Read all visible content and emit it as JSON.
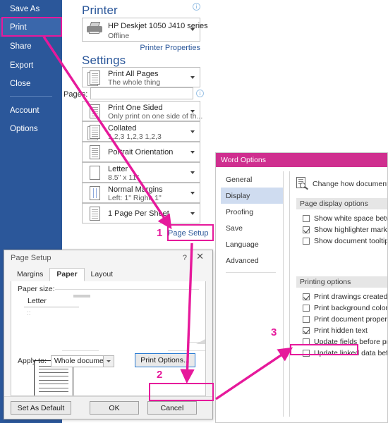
{
  "backstage": {
    "items": [
      {
        "label": "Save As",
        "selected": false
      },
      {
        "label": "Print",
        "selected": true
      },
      {
        "label": "Share",
        "selected": false
      },
      {
        "label": "Export",
        "selected": false
      },
      {
        "label": "Close",
        "selected": false
      },
      {
        "label": "Account",
        "selected": false
      },
      {
        "label": "Options",
        "selected": false
      }
    ]
  },
  "print_pane": {
    "printer_heading": "Printer",
    "printer_name": "HP Deskjet 1050 J410 series",
    "printer_status": "Offline",
    "printer_properties_link": "Printer Properties",
    "settings_heading": "Settings",
    "pages_label": "Pages:",
    "pages_value": "",
    "page_setup_link": "Page Setup",
    "info_icon": "info-icon",
    "settings": [
      {
        "icon": "document-icon",
        "line1": "Print All Pages",
        "line2": "The whole thing"
      },
      {
        "icon": "one-sided-icon",
        "line1": "Print One Sided",
        "line2": "Only print on one side of th..."
      },
      {
        "icon": "collated-icon",
        "line1": "Collated",
        "line2": "1,2,3   1,2,3   1,2,3"
      },
      {
        "icon": "orientation-icon",
        "line1": "Portrait Orientation",
        "line2": ""
      },
      {
        "icon": "paper-size-icon",
        "line1": "Letter",
        "line2": "8.5\" x 11\""
      },
      {
        "icon": "margins-icon",
        "line1": "Normal Margins",
        "line2": "Left:  1\"    Right:  1\""
      },
      {
        "icon": "pages-per-sheet-icon",
        "line1": "1 Page Per Sheet",
        "line2": ""
      }
    ]
  },
  "word_options": {
    "title": "Word Options",
    "nav": [
      {
        "label": "General",
        "selected": false
      },
      {
        "label": "Display",
        "selected": true
      },
      {
        "label": "Proofing",
        "selected": false
      },
      {
        "label": "Save",
        "selected": false
      },
      {
        "label": "Language",
        "selected": false
      },
      {
        "label": "Advanced",
        "selected": false
      }
    ],
    "header_text": "Change how document content is",
    "page_display_heading": "Page display options",
    "page_display_options": [
      {
        "label": "Show white space between pages in Pri",
        "checked": false,
        "info": false
      },
      {
        "label": "Show highlighter marks",
        "checked": true,
        "info": true
      },
      {
        "label": "Show document tooltips",
        "checked": false,
        "info": false
      }
    ],
    "printing_heading": "Printing options",
    "printing_options": [
      {
        "label": "Print drawings created in Word",
        "checked": true,
        "info": true
      },
      {
        "label": "Print background colors and images",
        "checked": false,
        "info": false
      },
      {
        "label": "Print document properties",
        "checked": false,
        "info": false
      },
      {
        "label": "Print hidden text",
        "checked": true,
        "info": false
      },
      {
        "label": "Update fields before printing",
        "checked": false,
        "info": false
      },
      {
        "label": "Update linked data before printing",
        "checked": false,
        "info": false
      }
    ]
  },
  "page_setup": {
    "title": "Page Setup",
    "help_icon": "?",
    "close_icon": "✕",
    "tabs": [
      {
        "label": "Margins",
        "active": false
      },
      {
        "label": "Paper",
        "active": true
      },
      {
        "label": "Layout",
        "active": false
      }
    ],
    "paper_size_label": "Paper size:",
    "paper_size_value": "Letter",
    "apply_to_label": "Apply to:",
    "apply_to_value": "Whole document",
    "print_options_button": "Print Options...",
    "set_as_default_button": "Set As Default",
    "ok_button": "OK",
    "cancel_button": "Cancel"
  },
  "annotations": {
    "color": "#e6199b",
    "steps": [
      {
        "number": "1",
        "target": "Page Setup"
      },
      {
        "number": "2",
        "target": "Print Options..."
      },
      {
        "number": "3",
        "target": "Print hidden text"
      }
    ]
  }
}
